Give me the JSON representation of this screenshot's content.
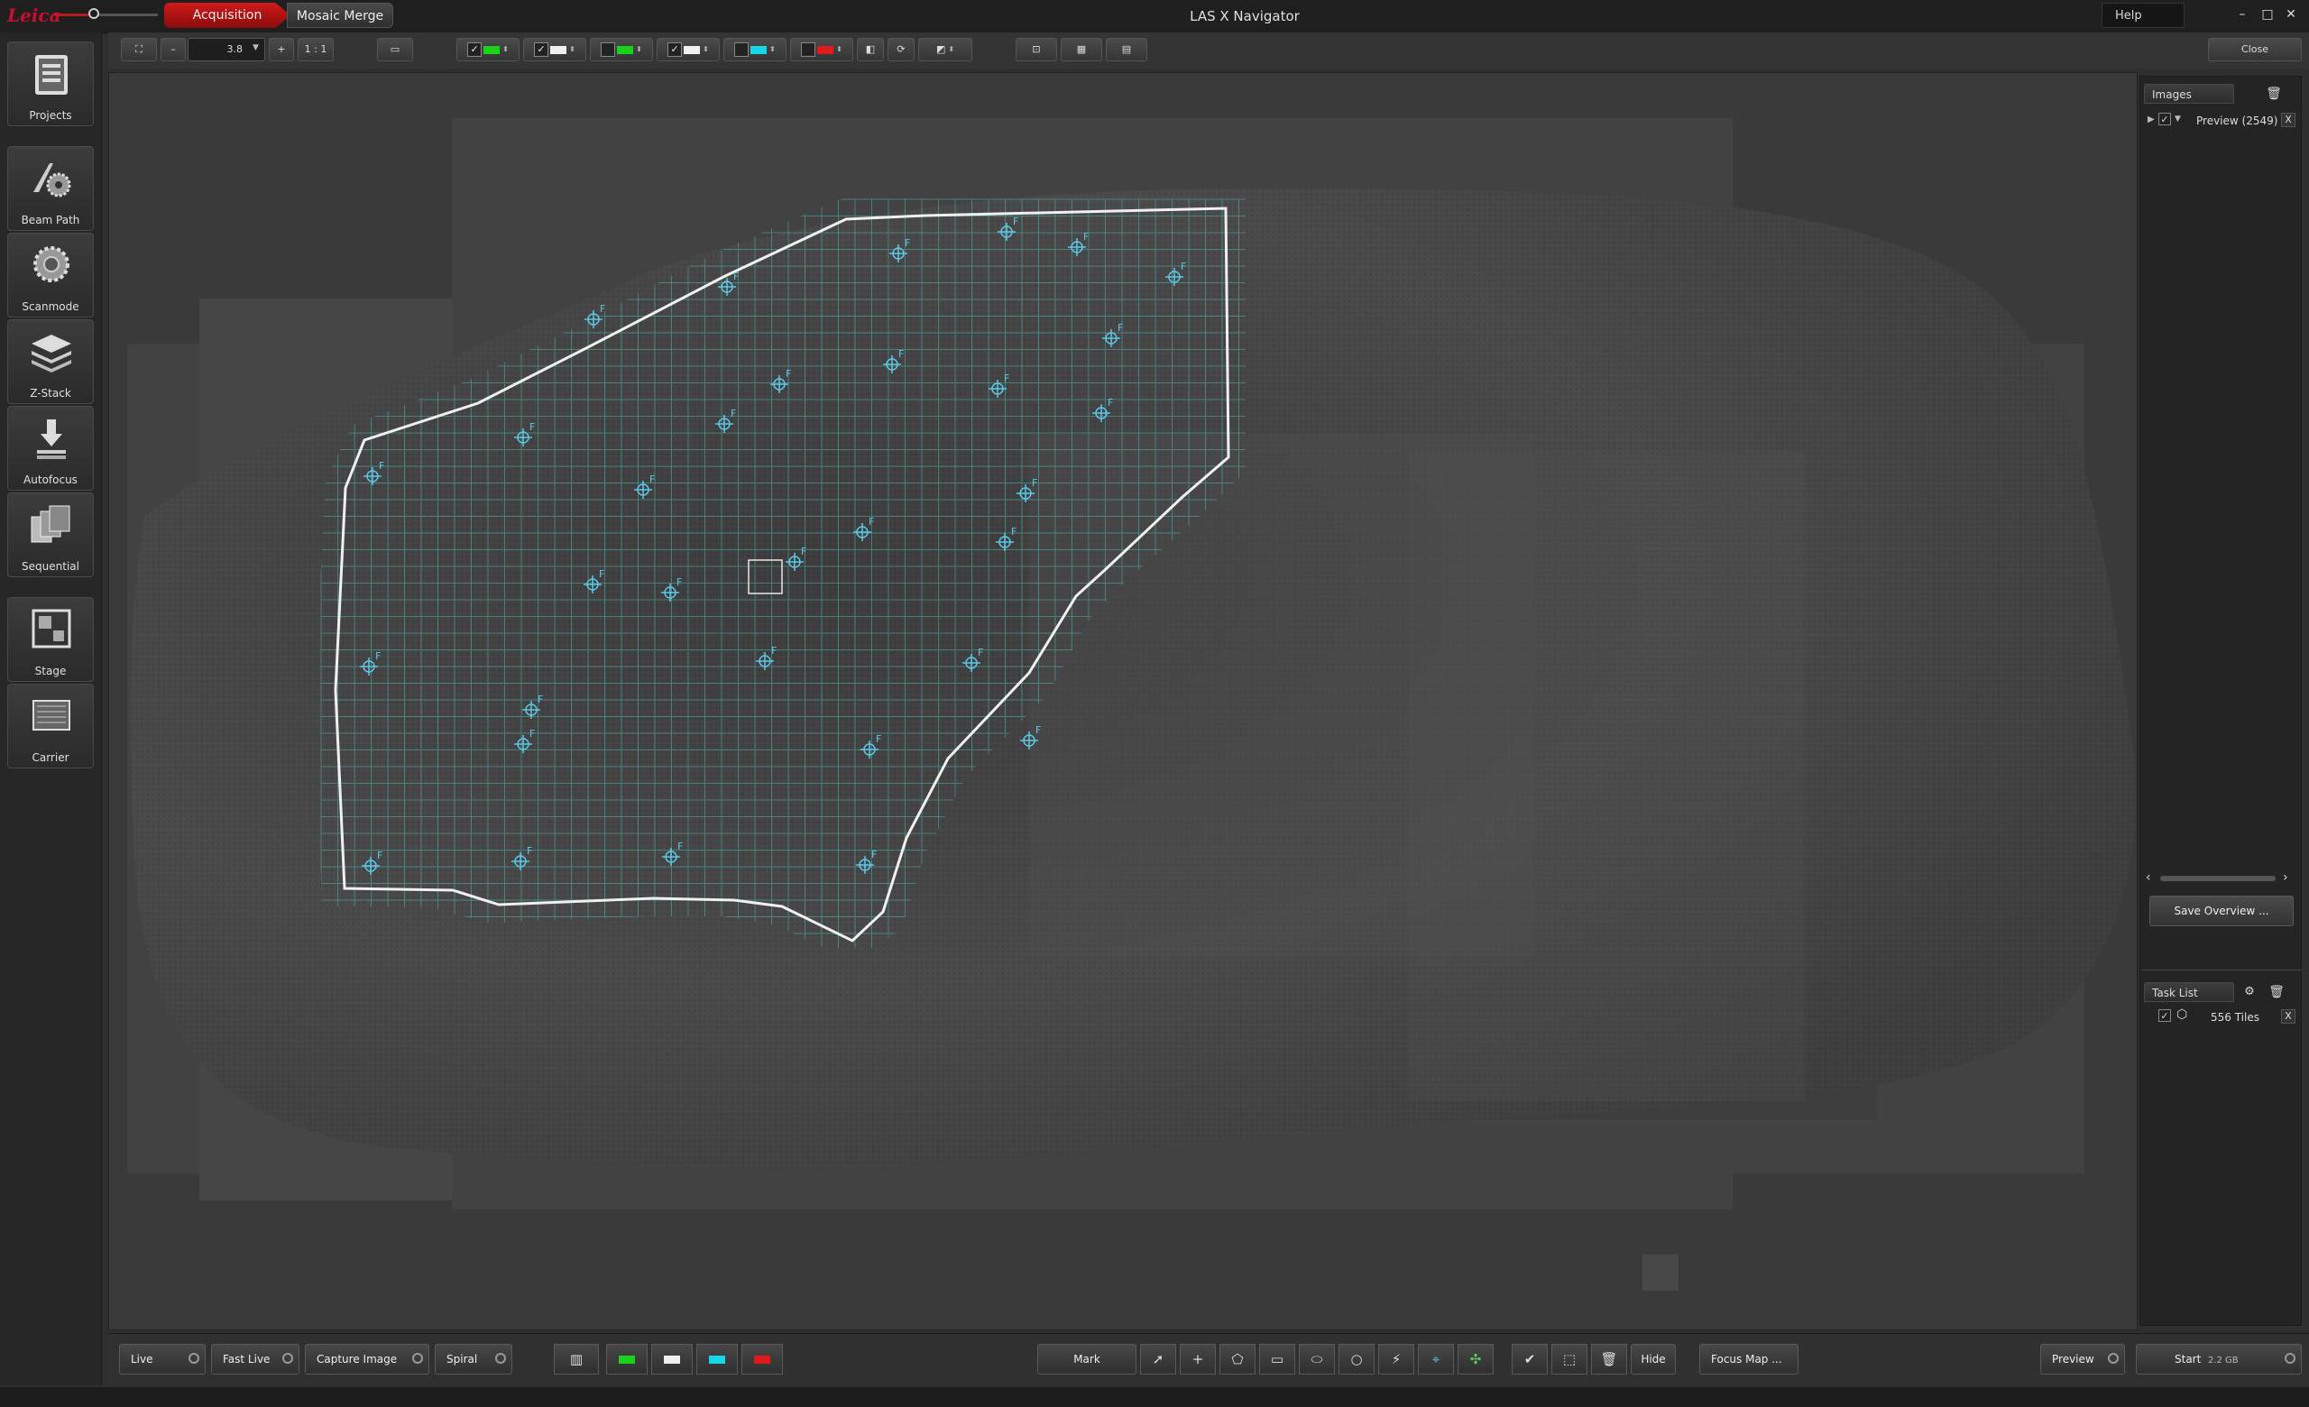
{
  "window": {
    "app_title": "LAS X Navigator",
    "logo_text": "Leica",
    "tabs": [
      {
        "label": "Acquisition",
        "active": true
      },
      {
        "label": "Mosaic Merge",
        "active": false
      }
    ],
    "help_label": "Help",
    "controls": {
      "minimize": "–",
      "maximize": "□",
      "close": "✕"
    }
  },
  "toolbar": {
    "zoom_minus": "–",
    "zoom_value": "3.8",
    "zoom_plus": "+",
    "one_to_one": "1 : 1",
    "close_label": "Close",
    "channels": [
      {
        "checked": true,
        "color": "#19d219"
      },
      {
        "checked": true,
        "color": "#f0f0f0"
      },
      {
        "checked": false,
        "color": "#19d219"
      },
      {
        "checked": true,
        "color": "#f0f0f0"
      },
      {
        "checked": false,
        "color": "#16d7e6"
      },
      {
        "checked": false,
        "color": "#e01b1b"
      }
    ]
  },
  "sidebar": {
    "items": [
      {
        "label": "Projects",
        "icon": "projects-icon"
      },
      {
        "label": "Beam Path",
        "icon": "beam-path-icon"
      },
      {
        "label": "Scanmode",
        "icon": "scanmode-icon"
      },
      {
        "label": "Z-Stack",
        "icon": "z-stack-icon"
      },
      {
        "label": "Autofocus",
        "icon": "autofocus-icon"
      },
      {
        "label": "Sequential",
        "icon": "sequential-icon"
      },
      {
        "label": "Stage",
        "icon": "stage-icon"
      },
      {
        "label": "Carrier",
        "icon": "carrier-icon"
      }
    ]
  },
  "canvas": {
    "focus_marker_label": "F",
    "outline_color": "#f0f0f0",
    "grid_color": "#4fb3b3",
    "marker_color": "#5ec8e8"
  },
  "images_panel": {
    "header": "Images",
    "items": [
      {
        "checked": true,
        "label": "Preview (2549)",
        "remove": "X"
      }
    ],
    "save_overview": "Save Overview ..."
  },
  "tasklist_panel": {
    "header": "Task List",
    "items": [
      {
        "checked": true,
        "label": "556 Tiles",
        "remove": "X"
      }
    ]
  },
  "bottombar": {
    "live": "Live",
    "fast_live": "Fast Live",
    "capture_image": "Capture Image",
    "spiral": "Spiral",
    "channel_colors": [
      "#19d219",
      "#f0f0f0",
      "#16d7e6",
      "#e01b1b"
    ],
    "mark": "Mark",
    "hide": "Hide",
    "focus_map": "Focus Map ...",
    "preview": "Preview",
    "start": "Start",
    "start_size": "2.2 GB"
  }
}
